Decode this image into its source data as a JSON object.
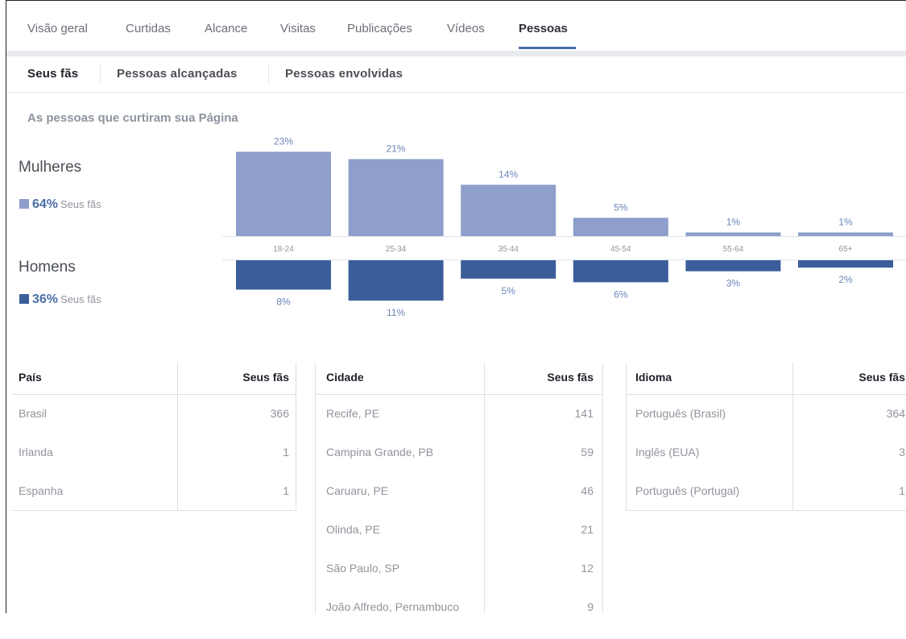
{
  "tabs": [
    "Visão geral",
    "Curtidas",
    "Alcance",
    "Visitas",
    "Publicações",
    "Vídeos",
    "Pessoas"
  ],
  "active_tab": "Pessoas",
  "sub_tabs": [
    "Seus fãs",
    "Pessoas alcançadas",
    "Pessoas envolvidas"
  ],
  "active_sub_tab": "Seus fãs",
  "section_title": "As pessoas que curtiram sua Página",
  "women": {
    "title": "Mulheres",
    "pct": "64%",
    "label": "Seus fãs"
  },
  "men": {
    "title": "Homens",
    "pct": "36%",
    "label": "Seus fãs"
  },
  "colors": {
    "women": "#8d9fca",
    "men": "#3b5e9a",
    "pct_text": "#6b86b8"
  },
  "chart_data": {
    "type": "bar",
    "categories": [
      "18-24",
      "25-34",
      "35-44",
      "45-54",
      "55-64",
      "65+"
    ],
    "series": [
      {
        "name": "Mulheres",
        "values": [
          23,
          21,
          14,
          5,
          1,
          1
        ]
      },
      {
        "name": "Homens",
        "values": [
          8,
          11,
          5,
          6,
          3,
          2
        ]
      }
    ]
  },
  "tables": {
    "country": {
      "headers": [
        "País",
        "Seus fãs"
      ],
      "rows": [
        [
          "Brasil",
          "366"
        ],
        [
          "Irlanda",
          "1"
        ],
        [
          "Espanha",
          "1"
        ]
      ]
    },
    "city": {
      "headers": [
        "Cidade",
        "Seus fãs"
      ],
      "rows": [
        [
          "Recife, PE",
          "141"
        ],
        [
          "Campina Grande, PB",
          "59"
        ],
        [
          "Caruaru, PE",
          "46"
        ],
        [
          "Olinda, PE",
          "21"
        ],
        [
          "São Paulo, SP",
          "12"
        ],
        [
          "João Alfredo, Pernambuco",
          "9"
        ]
      ]
    },
    "language": {
      "headers": [
        "Idioma",
        "Seus fãs"
      ],
      "rows": [
        [
          "Português (Brasil)",
          "364"
        ],
        [
          "Inglês (EUA)",
          "3"
        ],
        [
          "Português (Portugal)",
          "1"
        ]
      ]
    }
  }
}
